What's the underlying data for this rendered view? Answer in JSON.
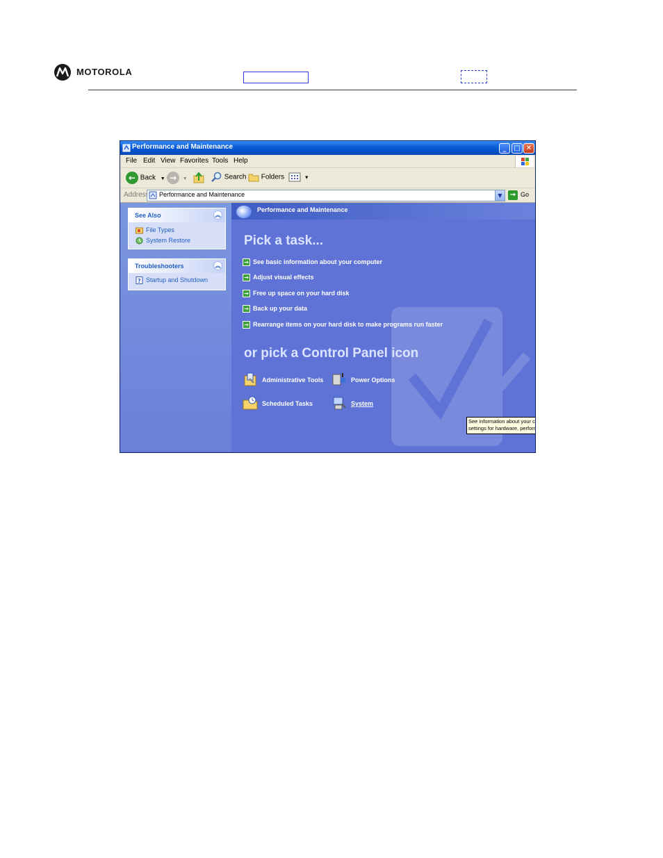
{
  "page": {
    "brand": "MOTOROLA",
    "colors": {
      "page_bg": "#ffffff",
      "link_box": "#2b3bd1"
    }
  },
  "window": {
    "title": "Performance and Maintenance",
    "controls": {
      "minimize": "_",
      "maximize": "□",
      "close": "✕"
    },
    "menu": [
      "File",
      "Edit",
      "View",
      "Favorites",
      "Tools",
      "Help"
    ],
    "toolbar": {
      "back_label": "Back",
      "search_label": "Search",
      "folders_label": "Folders"
    },
    "address": {
      "label": "Address",
      "value": "Performance and Maintenance",
      "go_label": "Go"
    },
    "sidebar": {
      "see_also": {
        "title": "See Also",
        "items": [
          {
            "label": "File Types",
            "icon": "file-types-icon"
          },
          {
            "label": "System Restore",
            "icon": "system-restore-icon"
          }
        ]
      },
      "troubleshooters": {
        "title": "Troubleshooters",
        "items": [
          {
            "label": "Startup and Shutdown",
            "icon": "help-icon"
          }
        ]
      }
    },
    "main": {
      "header": "Performance and Maintenance",
      "pick_task_title": "Pick a task...",
      "tasks": [
        "See basic information about your computer",
        "Adjust visual effects",
        "Free up space on your hard disk",
        "Back up your data",
        "Rearrange items on your hard disk to make programs run faster"
      ],
      "pick_icon_title": "or pick a Control Panel icon",
      "icons": [
        {
          "label": "Administrative Tools",
          "icon": "administrative-tools-icon"
        },
        {
          "label": "Power Options",
          "icon": "power-options-icon"
        },
        {
          "label": "Scheduled Tasks",
          "icon": "scheduled-tasks-icon"
        },
        {
          "label": "System",
          "icon": "system-icon"
        }
      ],
      "tooltip": "See information about your computer system, and change settings for hardware, performance, and automatic updates."
    },
    "colors": {
      "titlebar": "#0550c8",
      "content_bg": "#5f73d6",
      "sidebar_bg": "#7b97e0",
      "task_arrow": "#3da23d",
      "panel_header_text": "#215dc6"
    }
  }
}
